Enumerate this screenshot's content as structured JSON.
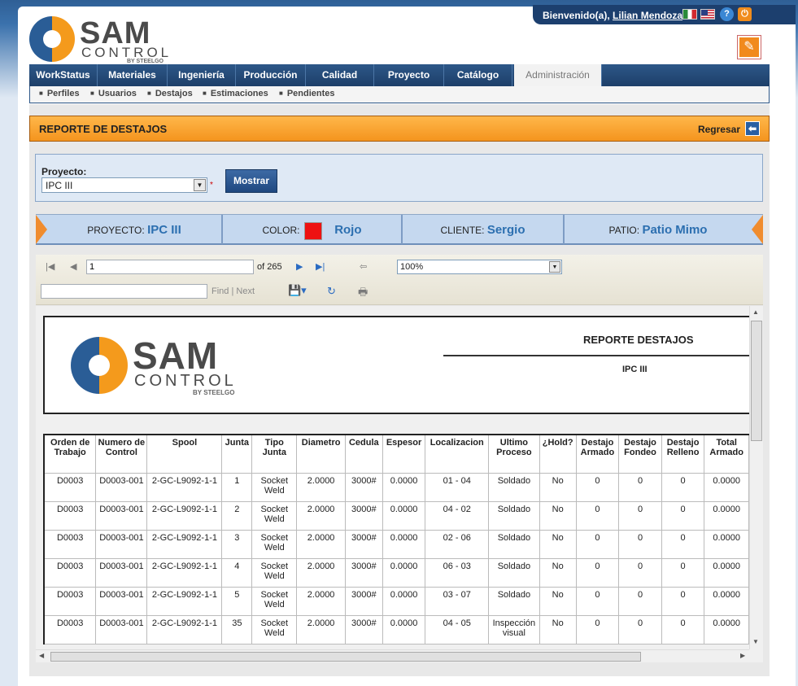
{
  "header": {
    "welcome": "Bienvenido(a),",
    "user": "Lilian Mendoza",
    "logo_text": "SAM",
    "logo_sub": "CONTROL",
    "logo_by": "BY STEELGO"
  },
  "nav": {
    "items": [
      "WorkStatus",
      "Materiales",
      "Ingeniería",
      "Producción",
      "Calidad",
      "Proyecto",
      "Catálogo",
      "Administración"
    ],
    "active": "Administración"
  },
  "subnav": [
    "Perfiles",
    "Usuarios",
    "Destajos",
    "Estimaciones",
    "Pendientes"
  ],
  "page": {
    "title": "REPORTE DE DESTAJOS",
    "back_label": "Regresar"
  },
  "filter": {
    "label": "Proyecto:",
    "selected": "IPC III",
    "required_mark": "*",
    "button": "Mostrar"
  },
  "info": {
    "proyecto_label": "PROYECTO:",
    "proyecto": "IPC III",
    "color_label": "COLOR:",
    "color_value": "Rojo",
    "color_hex": "#ee1111",
    "cliente_label": "CLIENTE:",
    "cliente": "Sergio",
    "patio_label": "PATIO:",
    "patio": "Patio Mimo"
  },
  "viewer": {
    "page": "1",
    "of_pages": "of 265",
    "zoom": "100%",
    "find": "Find",
    "separator": "|",
    "next": "Next"
  },
  "report": {
    "title": "REPORTE DESTAJOS",
    "subtitle": "IPC III",
    "columns": [
      "Orden de Trabajo",
      "Numero de Control",
      "Spool",
      "Junta",
      "Tipo Junta",
      "Diametro",
      "Cedula",
      "Espesor",
      "Localizacion",
      "Ultimo Proceso",
      "¿Hold?",
      "Destajo Armado",
      "Destajo Fondeo",
      "Destajo Relleno",
      "Total Armado"
    ],
    "rows": [
      [
        "D0003",
        "D0003-001",
        "2-GC-L9092-1-1",
        "1",
        "Socket Weld",
        "2.0000",
        "3000#",
        "0.0000",
        "01 - 04",
        "Soldado",
        "No",
        "0",
        "0",
        "0",
        "0.0000"
      ],
      [
        "D0003",
        "D0003-001",
        "2-GC-L9092-1-1",
        "2",
        "Socket Weld",
        "2.0000",
        "3000#",
        "0.0000",
        "04 - 02",
        "Soldado",
        "No",
        "0",
        "0",
        "0",
        "0.0000"
      ],
      [
        "D0003",
        "D0003-001",
        "2-GC-L9092-1-1",
        "3",
        "Socket Weld",
        "2.0000",
        "3000#",
        "0.0000",
        "02 - 06",
        "Soldado",
        "No",
        "0",
        "0",
        "0",
        "0.0000"
      ],
      [
        "D0003",
        "D0003-001",
        "2-GC-L9092-1-1",
        "4",
        "Socket Weld",
        "2.0000",
        "3000#",
        "0.0000",
        "06 - 03",
        "Soldado",
        "No",
        "0",
        "0",
        "0",
        "0.0000"
      ],
      [
        "D0003",
        "D0003-001",
        "2-GC-L9092-1-1",
        "5",
        "Socket Weld",
        "2.0000",
        "3000#",
        "0.0000",
        "03 - 07",
        "Soldado",
        "No",
        "0",
        "0",
        "0",
        "0.0000"
      ],
      [
        "D0003",
        "D0003-001",
        "2-GC-L9092-1-1",
        "35",
        "Socket Weld",
        "2.0000",
        "3000#",
        "0.0000",
        "04 - 05",
        "Inspección visual",
        "No",
        "0",
        "0",
        "0",
        "0.0000"
      ]
    ]
  }
}
